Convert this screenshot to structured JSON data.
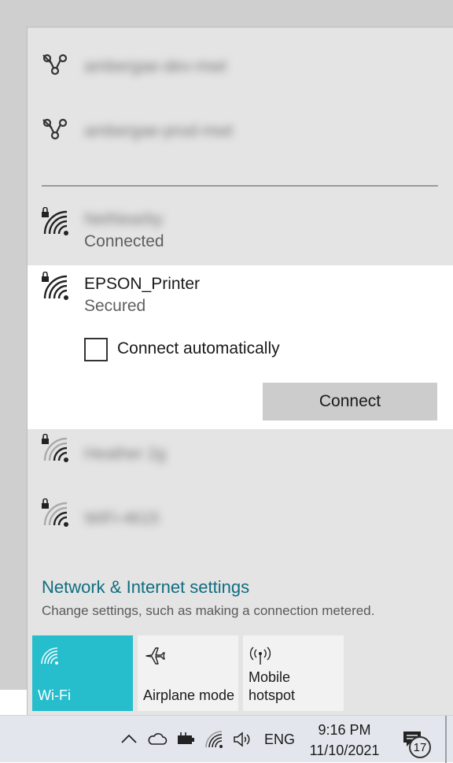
{
  "networks_top": [
    {
      "name": "ambergae-dev-mwt"
    },
    {
      "name": "ambergae-prod-mwt"
    }
  ],
  "connected_network": {
    "name": "NetNearby",
    "status": "Connected"
  },
  "selected_network": {
    "name": "EPSON_Printer",
    "status": "Secured",
    "auto_label": "Connect automatically",
    "connect_label": "Connect"
  },
  "networks_bottom": [
    {
      "name": "Heather 2g"
    },
    {
      "name": "WiFi-4615"
    }
  ],
  "settings": {
    "link": "Network & Internet settings",
    "description": "Change settings, such as making a connection metered."
  },
  "quick_actions": {
    "wifi": "Wi-Fi",
    "airplane": "Airplane mode",
    "hotspot_line1": "Mobile",
    "hotspot_line2": "hotspot"
  },
  "taskbar": {
    "language": "ENG",
    "time": "9:16 PM",
    "date": "11/10/2021",
    "notification_count": "17"
  },
  "colors": {
    "accent": "#26bdcc",
    "link": "#0e6e7f"
  }
}
